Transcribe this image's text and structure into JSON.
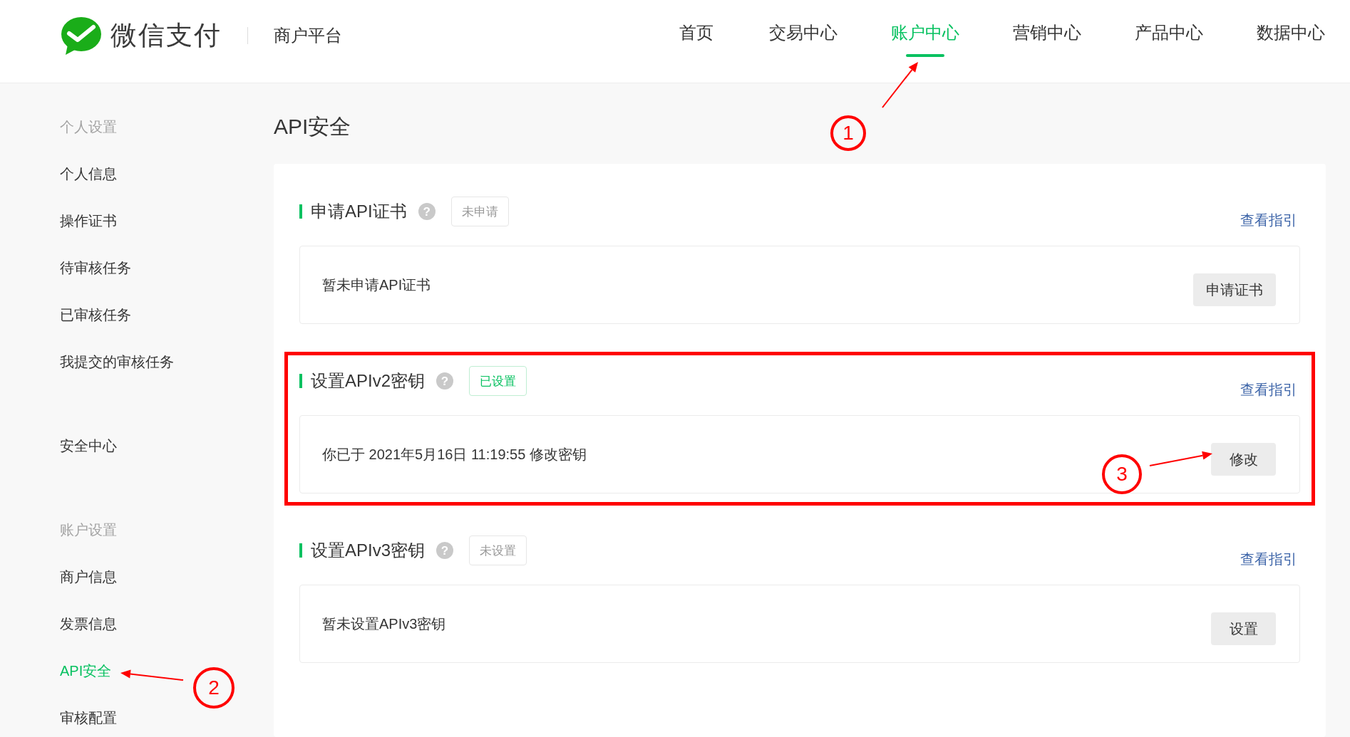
{
  "header": {
    "logo_text": "微信支付",
    "platform": "商户平台",
    "nav": [
      {
        "label": "首页",
        "selected": false
      },
      {
        "label": "交易中心",
        "selected": false
      },
      {
        "label": "账户中心",
        "selected": true
      },
      {
        "label": "营销中心",
        "selected": false
      },
      {
        "label": "产品中心",
        "selected": false
      },
      {
        "label": "数据中心",
        "selected": false
      }
    ]
  },
  "sidebar": {
    "groups": [
      {
        "title": "个人设置",
        "items": [
          {
            "label": "个人信息",
            "selected": false
          },
          {
            "label": "操作证书",
            "selected": false
          },
          {
            "label": "待审核任务",
            "selected": false
          },
          {
            "label": "已审核任务",
            "selected": false
          },
          {
            "label": "我提交的审核任务",
            "selected": false
          }
        ]
      },
      {
        "items": [
          {
            "label": "安全中心",
            "selected": false
          }
        ]
      },
      {
        "title": "账户设置",
        "items": [
          {
            "label": "商户信息",
            "selected": false
          },
          {
            "label": "发票信息",
            "selected": false
          },
          {
            "label": "API安全",
            "selected": true
          },
          {
            "label": "审核配置",
            "selected": false
          }
        ]
      }
    ]
  },
  "page_title": "API安全",
  "sections": [
    {
      "title": "申请API证书",
      "help_icon": "?",
      "status": {
        "label": "未申请",
        "done": false
      },
      "guide_link": "查看指引",
      "description": "暂未申请API证书",
      "action": "申请证书",
      "highlighted": false
    },
    {
      "title": "设置APIv2密钥",
      "help_icon": "?",
      "status": {
        "label": "已设置",
        "done": true
      },
      "guide_link": "查看指引",
      "description": "你已于 2021年5月16日 11:19:55 修改密钥",
      "action": "修改",
      "highlighted": true
    },
    {
      "title": "设置APIv3密钥",
      "help_icon": "?",
      "status": {
        "label": "未设置",
        "done": false
      },
      "guide_link": "查看指引",
      "description": "暂未设置APIv3密钥",
      "action": "设置",
      "highlighted": false
    }
  ],
  "callouts": [
    {
      "label": "1"
    },
    {
      "label": "2"
    },
    {
      "label": "3"
    }
  ]
}
